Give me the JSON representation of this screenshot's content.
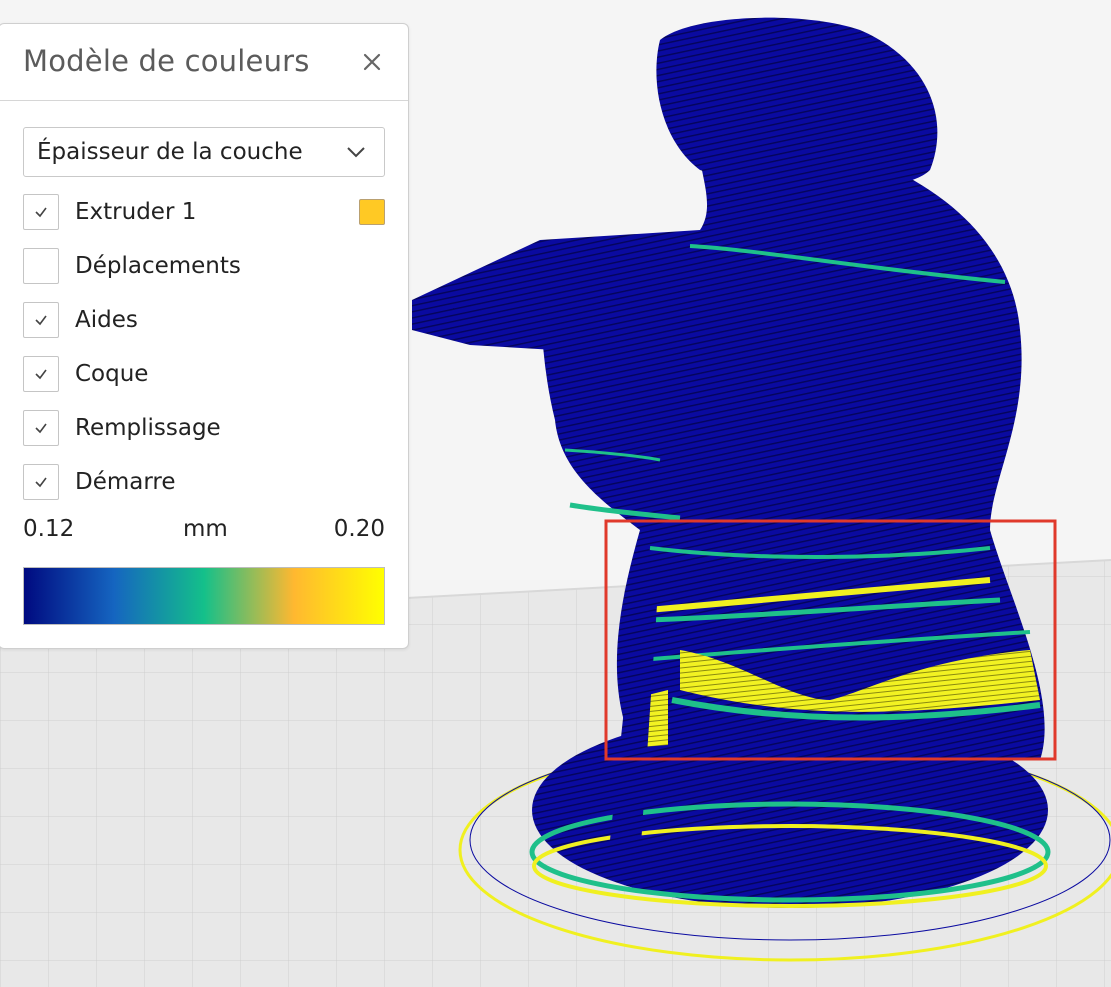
{
  "panel": {
    "title": "Modèle de couleurs",
    "color_scheme": "Épaisseur de la couche",
    "options": [
      {
        "label": "Extruder 1",
        "checked": true,
        "swatch_color": "#ffc924"
      },
      {
        "label": "Déplacements",
        "checked": false
      },
      {
        "label": "Aides",
        "checked": true
      },
      {
        "label": "Coque",
        "checked": true
      },
      {
        "label": "Remplissage",
        "checked": true
      },
      {
        "label": "Démarre",
        "checked": true
      }
    ],
    "legend": {
      "min": "0.12",
      "unit": "mm",
      "max": "0.20",
      "gradient": [
        "#000a80",
        "#1565c0",
        "#14c08a",
        "#ffb830",
        "#ffff00"
      ]
    }
  },
  "colors": {
    "model_blue": "#0a0aa0",
    "layer_teal": "#1fc08a",
    "layer_yellow": "#f0f020",
    "highlight_red": "#e0392b",
    "build_plate": "#e6e6e6"
  },
  "icons": {
    "close": "close-icon",
    "dropdown": "chevron-down-icon",
    "check": "check-icon"
  }
}
